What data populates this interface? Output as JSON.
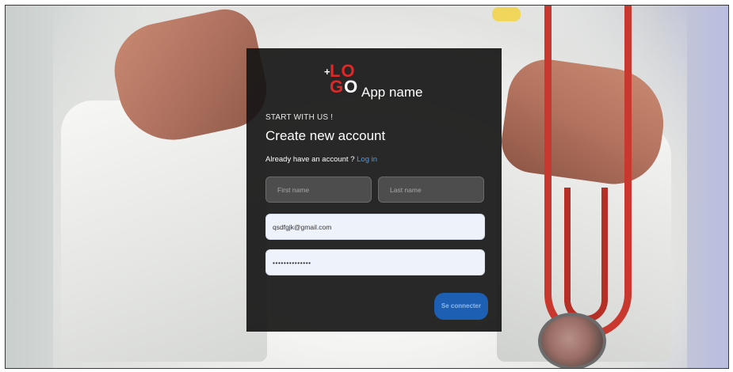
{
  "logo": {
    "plus": "+",
    "line1": "LO",
    "line2_first": "G",
    "line2_second": "O"
  },
  "app_name": "App name",
  "eyebrow": "START WITH US !",
  "title": "Create new account",
  "login_prompt": "Already have an account ?",
  "login_link": "Log in",
  "fields": {
    "first_name_placeholder": "First name",
    "last_name_placeholder": "Last name",
    "email_value": "qsdfgjk@gmail.com",
    "password_value": "••••••••••••••"
  },
  "submit_label": "Se connecter",
  "colors": {
    "logo_red": "#e02828",
    "link_blue": "#4a9be8",
    "button_blue": "#1d5fb3"
  }
}
